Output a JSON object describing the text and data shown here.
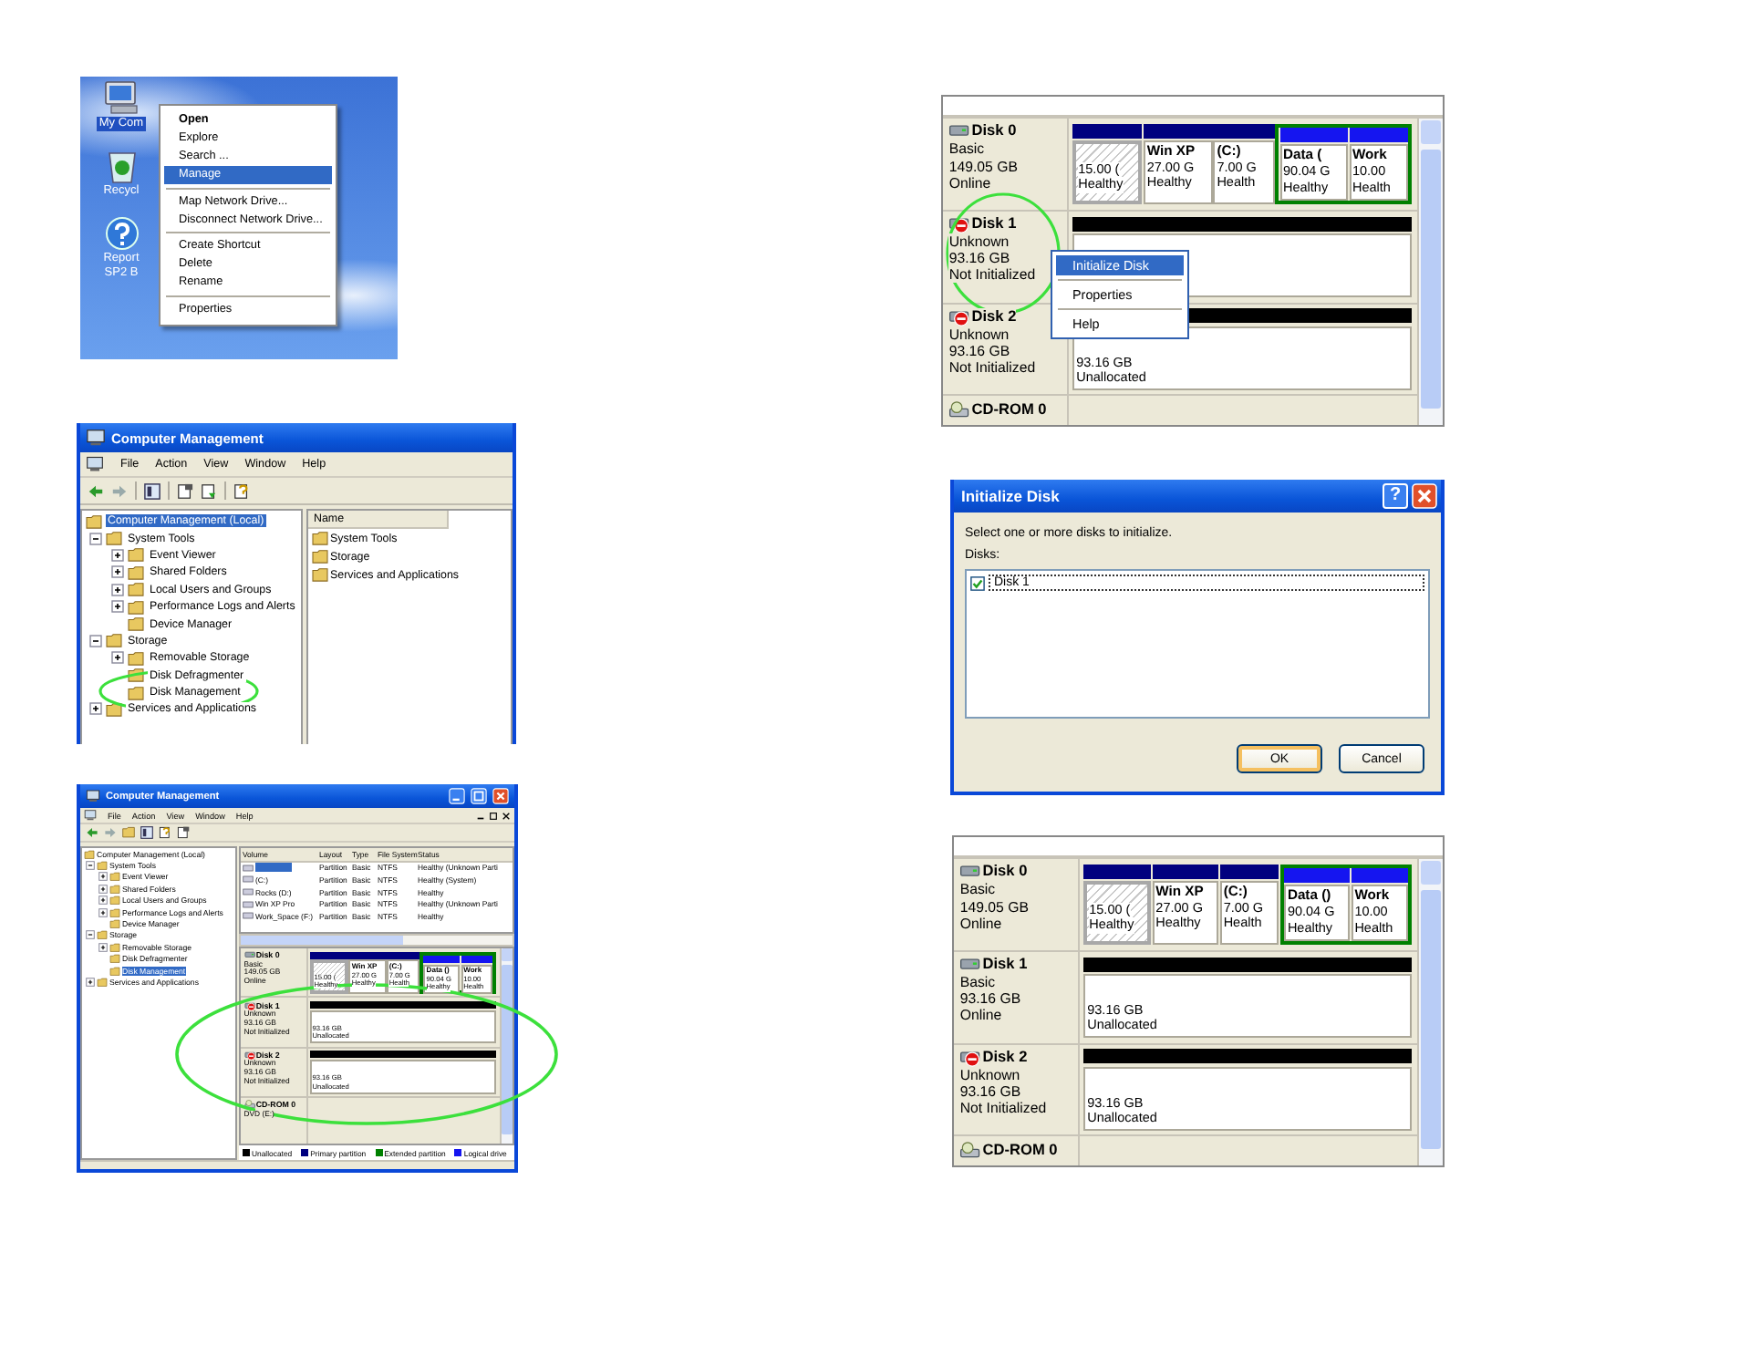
{
  "desktop_screenshot": {
    "icons": [
      {
        "kind": "computer",
        "lines": [
          "My Com"
        ],
        "selected": true
      },
      {
        "kind": "recycle_bin",
        "lines": [
          "Recycl"
        ],
        "selected": false
      },
      {
        "kind": "help",
        "lines": [
          "Report",
          "SP2 B"
        ],
        "selected": false
      }
    ],
    "context_menu": [
      [
        {
          "label": "Open",
          "default": true,
          "selected": false
        },
        {
          "label": "Explore",
          "default": false,
          "selected": false
        },
        {
          "label": "Search ...",
          "default": false,
          "selected": false
        },
        {
          "label": "Manage",
          "default": false,
          "selected": true
        }
      ],
      [
        {
          "label": "Map Network Drive...",
          "default": false,
          "selected": false
        },
        {
          "label": "Disconnect Network Drive...",
          "default": false,
          "selected": false
        }
      ],
      [
        {
          "label": "Create Shortcut",
          "default": false,
          "selected": false
        },
        {
          "label": "Delete",
          "default": false,
          "selected": false
        },
        {
          "label": "Rename",
          "default": false,
          "selected": false
        }
      ],
      [
        {
          "label": "Properties",
          "default": false,
          "selected": false
        }
      ]
    ]
  },
  "management_window": {
    "title": "Computer Management",
    "menu": [
      "File",
      "Action",
      "View",
      "Window",
      "Help"
    ],
    "tree": [
      {
        "label": "Computer Management (Local)",
        "expandable": false,
        "selected": true,
        "children": [
          {
            "label": "System Tools",
            "expandable": true,
            "expanded": true,
            "selected": false,
            "children": [
              {
                "label": "Event Viewer",
                "expandable": true,
                "expanded": false,
                "selected": false
              },
              {
                "label": "Shared Folders",
                "expandable": true,
                "expanded": false,
                "selected": false
              },
              {
                "label": "Local Users and Groups",
                "expandable": true,
                "expanded": false,
                "selected": false
              },
              {
                "label": "Performance Logs and Alerts",
                "expandable": true,
                "expanded": false,
                "selected": false
              },
              {
                "label": "Device Manager",
                "expandable": false,
                "selected": false
              }
            ]
          },
          {
            "label": "Storage",
            "expandable": true,
            "expanded": true,
            "selected": false,
            "children": [
              {
                "label": "Removable Storage",
                "expandable": true,
                "expanded": false,
                "selected": false
              },
              {
                "label": "Disk Defragmenter",
                "expandable": false,
                "selected": false
              },
              {
                "label": "Disk Management",
                "expandable": false,
                "selected": false
              }
            ]
          },
          {
            "label": "Services and Applications",
            "expandable": true,
            "expanded": false,
            "selected": false
          }
        ]
      }
    ],
    "list_header": "Name",
    "list_items": [
      "System Tools",
      "Storage",
      "Services and Applications"
    ]
  },
  "disk_management_window": {
    "title": "Computer Management",
    "menu": [
      "File",
      "Action",
      "View",
      "Window",
      "Help"
    ],
    "tree": [
      {
        "label": "Computer Management (Local)",
        "expandable": false,
        "selected": false,
        "children": [
          {
            "label": "System Tools",
            "expandable": true,
            "expanded": true,
            "selected": false,
            "children": [
              {
                "label": "Event Viewer",
                "expandable": true,
                "expanded": false,
                "selected": false
              },
              {
                "label": "Shared Folders",
                "expandable": true,
                "expanded": false,
                "selected": false
              },
              {
                "label": "Local Users and Groups",
                "expandable": true,
                "expanded": false,
                "selected": false
              },
              {
                "label": "Performance Logs and Alerts",
                "expandable": true,
                "expanded": false,
                "selected": false
              },
              {
                "label": "Device Manager",
                "expandable": false,
                "selected": false
              }
            ]
          },
          {
            "label": "Storage",
            "expandable": true,
            "expanded": true,
            "selected": false,
            "children": [
              {
                "label": "Removable Storage",
                "expandable": true,
                "expanded": false,
                "selected": false
              },
              {
                "label": "Disk Defragmenter",
                "expandable": false,
                "selected": false
              },
              {
                "label": "Disk Management",
                "expandable": false,
                "selected": true
              }
            ]
          },
          {
            "label": "Services and Applications",
            "expandable": true,
            "expanded": false,
            "selected": false
          }
        ]
      }
    ],
    "volume_columns": [
      "Volume",
      "Layout",
      "Type",
      "File System",
      "Status"
    ],
    "volumes": [
      {
        "layout": "Partition",
        "type": "Basic",
        "file_system": "NTFS",
        "status": "Healthy (Unknown Parti",
        "selected": true
      },
      {
        "volume": "(C:)",
        "layout": "Partition",
        "type": "Basic",
        "file_system": "NTFS",
        "status": "Healthy (System)",
        "selected": false
      },
      {
        "volume": "Rocks (D:)",
        "layout": "Partition",
        "type": "Basic",
        "file_system": "NTFS",
        "status": "Healthy",
        "selected": false
      },
      {
        "volume": "Win XP Pro",
        "layout": "Partition",
        "type": "Basic",
        "file_system": "NTFS",
        "status": "Healthy (Unknown Parti",
        "selected": false
      },
      {
        "volume": "Work_Space (F:)",
        "layout": "Partition",
        "type": "Basic",
        "file_system": "NTFS",
        "status": "Healthy",
        "selected": false
      }
    ],
    "disk_view": {
      "disks": [
        {
          "name": "Disk 0",
          "type": "Basic",
          "size": "149.05 GB",
          "status": "Online",
          "initialized": true,
          "partitions": [
            {
              "kind": "primary",
              "size": "15.00 (",
              "status": "Healthy",
              "selected": true
            },
            {
              "kind": "primary",
              "name": "Win XP",
              "size": "27.00 G",
              "status": "Healthy",
              "selected": false
            },
            {
              "kind": "primary",
              "name": "(C:)",
              "size": "7.00 G",
              "status": "Health",
              "selected": false
            },
            {
              "kind": "extended",
              "children": [
                {
                  "kind": "logical",
                  "name": "Data ()",
                  "size": "90.04 G",
                  "status": "Healthy",
                  "selected": false
                },
                {
                  "kind": "logical",
                  "name": "Work",
                  "size": "10.00",
                  "status": "Health",
                  "selected": false
                }
              ]
            }
          ]
        },
        {
          "name": "Disk 1",
          "type": "Unknown",
          "size": "93.16 GB",
          "status": "Not Initialized",
          "initialized": false,
          "partitions": [
            {
              "kind": "unallocated",
              "size": "93.16 GB",
              "status": "Unallocated",
              "selected": false
            }
          ]
        },
        {
          "name": "Disk 2",
          "type": "Unknown",
          "size": "93.16 GB",
          "status": "Not Initialized",
          "initialized": false,
          "partitions": [
            {
              "kind": "unallocated",
              "size": "93.16 GB",
              "status": "Unallocated",
              "selected": false
            }
          ]
        }
      ],
      "cdrom": {
        "name": "CD-ROM 0",
        "type": "DVD (E:)"
      }
    },
    "legend": [
      {
        "label": "Unallocated",
        "color": "#000000"
      },
      {
        "label": "Primary partition",
        "color": "#00007f"
      },
      {
        "label": "Extended partition",
        "color": "#008000"
      },
      {
        "label": "Logical drive",
        "color": "#1515f0"
      }
    ]
  },
  "disk_menu_screenshot": {
    "disk_view": {
      "disks": [
        {
          "name": "Disk 0",
          "type": "Basic",
          "size": "149.05 GB",
          "status": "Online",
          "initialized": true,
          "partitions": [
            {
              "kind": "primary",
              "size": "15.00 (",
              "status": "Healthy",
              "selected": true
            },
            {
              "kind": "primary",
              "name": "Win XP",
              "size": "27.00 G",
              "status": "Healthy",
              "selected": false
            },
            {
              "kind": "primary",
              "name": "(C:)",
              "size": "7.00 G",
              "status": "Health",
              "selected": false
            },
            {
              "kind": "extended",
              "children": [
                {
                  "kind": "logical",
                  "name": "Data (",
                  "size": "90.04 G",
                  "status": "Healthy",
                  "selected": false
                },
                {
                  "kind": "logical",
                  "name": "Work",
                  "size": "10.00",
                  "status": "Health",
                  "selected": false
                }
              ]
            }
          ]
        },
        {
          "name": "Disk 1",
          "type": "Unknown",
          "size": "93.16 GB",
          "status": "Not Initialized",
          "initialized": false,
          "partitions": [
            {
              "kind": "unallocated",
              "selected": false
            }
          ]
        },
        {
          "name": "Disk 2",
          "type": "Unknown",
          "size": "93.16 GB",
          "status": "Not Initialized",
          "initialized": false,
          "partitions": [
            {
              "kind": "unallocated",
              "size": "93.16 GB",
              "status": "Unallocated",
              "selected": false
            }
          ]
        }
      ],
      "cdrom": {
        "name": "CD-ROM 0"
      }
    },
    "context_menu": [
      [
        {
          "label": "Initialize Disk",
          "selected": true
        }
      ],
      [
        {
          "label": "Properties",
          "selected": false
        }
      ],
      [
        {
          "label": "Help",
          "selected": false
        }
      ]
    ]
  },
  "initialize_dialog": {
    "title": "Initialize Disk",
    "help_button": "?",
    "prompt": "Select one or more disks to initialize.",
    "list_label": "Disks:",
    "disks": [
      {
        "label": "Disk 1",
        "checked": true
      }
    ],
    "buttons": [
      {
        "label": "OK",
        "default": true
      },
      {
        "label": "Cancel",
        "default": false
      }
    ]
  },
  "result_screenshot": {
    "disk_view": {
      "disks": [
        {
          "name": "Disk 0",
          "type": "Basic",
          "size": "149.05 GB",
          "status": "Online",
          "initialized": true,
          "partitions": [
            {
              "kind": "primary",
              "size": "15.00 (",
              "status": "Healthy",
              "selected": true
            },
            {
              "kind": "primary",
              "name": "Win XP",
              "size": "27.00 G",
              "status": "Healthy",
              "selected": false
            },
            {
              "kind": "primary",
              "name": "(C:)",
              "size": "7.00 G",
              "status": "Health",
              "selected": false
            },
            {
              "kind": "extended",
              "children": [
                {
                  "kind": "logical",
                  "name": "Data ()",
                  "size": "90.04 G",
                  "status": "Healthy",
                  "selected": false
                },
                {
                  "kind": "logical",
                  "name": "Work",
                  "size": "10.00",
                  "status": "Health",
                  "selected": false
                }
              ]
            }
          ]
        },
        {
          "name": "Disk 1",
          "type": "Basic",
          "size": "93.16 GB",
          "status": "Online",
          "initialized": true,
          "partitions": [
            {
              "kind": "unallocated",
              "size": "93.16 GB",
              "status": "Unallocated",
              "selected": false
            }
          ]
        },
        {
          "name": "Disk 2",
          "type": "Unknown",
          "size": "93.16 GB",
          "status": "Not Initialized",
          "initialized": false,
          "partitions": [
            {
              "kind": "unallocated",
              "size": "93.16 GB",
              "status": "Unallocated",
              "selected": false
            }
          ]
        }
      ],
      "cdrom": {
        "name": "CD-ROM 0"
      }
    }
  }
}
